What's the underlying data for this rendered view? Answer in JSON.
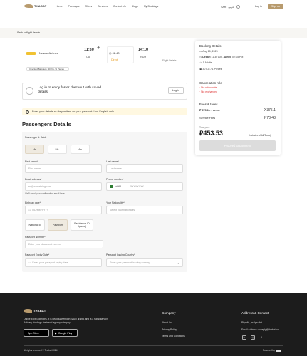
{
  "header": {
    "logo_text": "THABAT",
    "nav": [
      "Home",
      "Packages",
      "Offers",
      "Services",
      "Contact Us",
      "Blogs",
      "My Bookings"
    ],
    "currency": "SAR",
    "language": "عربي",
    "login_label": "Log in",
    "signup_label": "Sign up"
  },
  "back_label": "Back to flight details",
  "flight": {
    "airline": "Nesma Airlines",
    "baggage": "Checked Baggage: 30 KG / 1 Pieces",
    "depart_time": "11:30",
    "depart_code": "CAI",
    "duration": "02:40",
    "stops": "Direct",
    "arrive_time": "14:10",
    "arrive_code": "RUH",
    "details_label": "Flight Details"
  },
  "login_prompt": {
    "text": "Log in to enjoy faster checkout with saved details",
    "button": "Log in"
  },
  "notice": "Enter your details as they written on your passport. Use English only.",
  "passengers": {
    "title": "Passengers Details",
    "passenger_label": "Passenger 1: Adult",
    "titles": [
      "Mr.",
      "Ms.",
      "Mrs."
    ],
    "first_name": {
      "label": "First name*",
      "placeholder": "First name"
    },
    "last_name": {
      "label": "Last name*",
      "placeholder": "Last name"
    },
    "email": {
      "label": "Email address*",
      "placeholder": "ex@something.com"
    },
    "phone": {
      "label": "Phone number*",
      "code": "+966",
      "placeholder": "5XXXXXXX"
    },
    "help": "We'll send your confirmation email here.",
    "birthday": {
      "label": "Birthday date*",
      "placeholder": "DD/MM/YYYY"
    },
    "nationality": {
      "label": "Your Nationality*",
      "placeholder": "Select your nationality"
    },
    "doc_types": [
      "National id",
      "Passport",
      "Residence ID (Igama)"
    ],
    "passport_number": {
      "label": "Passport Number*",
      "placeholder": "Enter your document number"
    },
    "passport_expiry": {
      "label": "Passport Expiry Date*",
      "placeholder": "Enter your passport expiry date"
    },
    "issuing_country": {
      "label": "Passport Issuing Country*",
      "placeholder": "Enter your passport issuing country"
    }
  },
  "booking": {
    "title": "Booking Details",
    "date": "Aug 15, 2025",
    "depart": "Depart",
    "depart_time": "11:30 AM",
    "arrive": "Arrive",
    "arrive_time": "02:15 PM",
    "adults": "1 Adults",
    "baggage": "30 KG / 1 Pieces",
    "cancel_title": "Cancelation rule",
    "non_refundable": "Not refundable",
    "non_exchange": "Not exchanged",
    "fees_title": "Fees & taxes",
    "fare": "375.1",
    "fare_note": "x 1 traveler",
    "fare_total": "375.1",
    "service_label": "Service Fees",
    "service_value": "78.43",
    "total_label": "Total price",
    "total": "453.53",
    "incl": "(Inclusive of All Taxes)",
    "pay": "Proceed to payment"
  },
  "footer": {
    "logo_text": "THABAT",
    "desc": "Online travel agencies, It is headquartered in Saudi arabia, and is a subsidiary of Bokhary Holdings the travel agency category.",
    "app_store": "App Store",
    "google_play": "Google Play",
    "company_title": "Company",
    "company_links": [
      "About Us",
      "Privacy Policy",
      "Terms and Conditions"
    ],
    "address_title": "Address & Contact",
    "address": "Riyadh , malga dist",
    "email": "Email Address: noreply@thabat.co",
    "copyright": "All rights reserved © Thabat 2024",
    "powered": "Powered by"
  },
  "colors": {
    "accent": "#b89b6e",
    "danger": "#d33333",
    "direct": "#e69b1e",
    "footer": "#1c1c1c"
  }
}
